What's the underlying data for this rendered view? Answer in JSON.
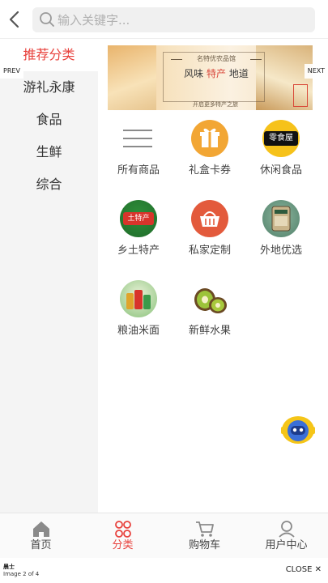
{
  "search": {
    "placeholder": "输入关键字..."
  },
  "sidebar": {
    "items": [
      {
        "label": "推荐分类",
        "active": true
      },
      {
        "label": "游礼永康",
        "active": false
      },
      {
        "label": "食品",
        "active": false
      },
      {
        "label": "生鲜",
        "active": false
      },
      {
        "label": "综合",
        "active": false
      }
    ]
  },
  "banner": {
    "tag": "名特优农品馆",
    "title_parts": [
      "风味",
      "特产",
      "地道"
    ],
    "tagline": "开启更多特产之旅",
    "stamp": "特江之美"
  },
  "carousel": {
    "prev": "PREV",
    "next": "NEXT"
  },
  "categories": [
    {
      "label": "所有商品",
      "icon": "list-icon"
    },
    {
      "label": "礼盒卡券",
      "icon": "gift-box-icon"
    },
    {
      "label": "休闲食品",
      "icon": "snack-shop-icon",
      "badge": "零食屋"
    },
    {
      "label": "乡土特产",
      "icon": "local-specialty-icon",
      "badge": "土特产"
    },
    {
      "label": "私家定制",
      "icon": "basket-icon"
    },
    {
      "label": "外地优选",
      "icon": "regional-product-icon"
    },
    {
      "label": "粮油米面",
      "icon": "grain-oil-icon"
    },
    {
      "label": "新鲜水果",
      "icon": "kiwi-fruit-icon"
    }
  ],
  "tabbar": [
    {
      "label": "首页",
      "icon": "home-icon",
      "active": false
    },
    {
      "label": "分类",
      "icon": "category-icon",
      "active": true
    },
    {
      "label": "购物车",
      "icon": "cart-icon",
      "active": false
    },
    {
      "label": "用户中心",
      "icon": "user-icon",
      "active": false
    }
  ],
  "viewer": {
    "caption": "晨士",
    "counter": "Image 2 of 4",
    "close": "CLOSE"
  },
  "colors": {
    "accent": "#e8413c",
    "sidebar_bg": "#f4f4f4",
    "search_bg": "#f0f0f0"
  }
}
